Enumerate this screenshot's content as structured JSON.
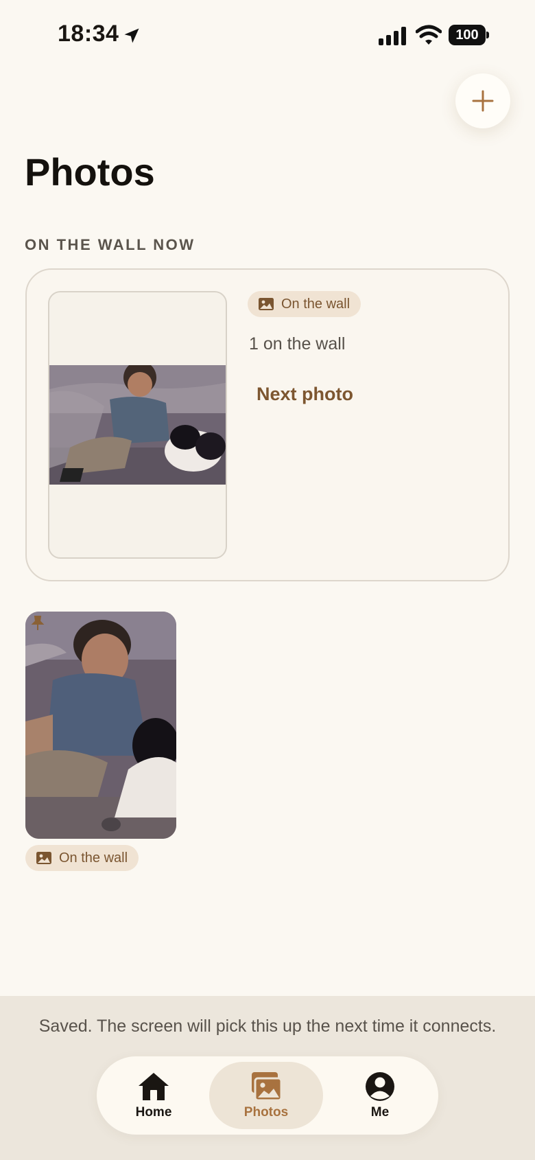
{
  "status_bar": {
    "time": "18:34",
    "battery": "100"
  },
  "header": {
    "title": "Photos",
    "add_button": "add-photo"
  },
  "section": {
    "label": "ON THE WALL NOW"
  },
  "wall_card": {
    "badge_label": "On the wall",
    "count_text": "1 on the wall",
    "next_button_label": "Next photo"
  },
  "photos": [
    {
      "badge_label": "On the wall",
      "pinned": true
    }
  ],
  "toast": {
    "message": "Saved. The screen will pick this up the next time it connects."
  },
  "tab_bar": {
    "items": [
      {
        "label": "Home",
        "icon": "home-icon",
        "active": false
      },
      {
        "label": "Photos",
        "icon": "photos-icon",
        "active": true
      },
      {
        "label": "Me",
        "icon": "person-icon",
        "active": false
      }
    ]
  },
  "colors": {
    "background": "#fbf8f2",
    "accent": "#a8723f",
    "accent_dark": "#7d5630",
    "badge_bg": "#f0e3d3",
    "bottom_bg": "#ece6dc"
  }
}
